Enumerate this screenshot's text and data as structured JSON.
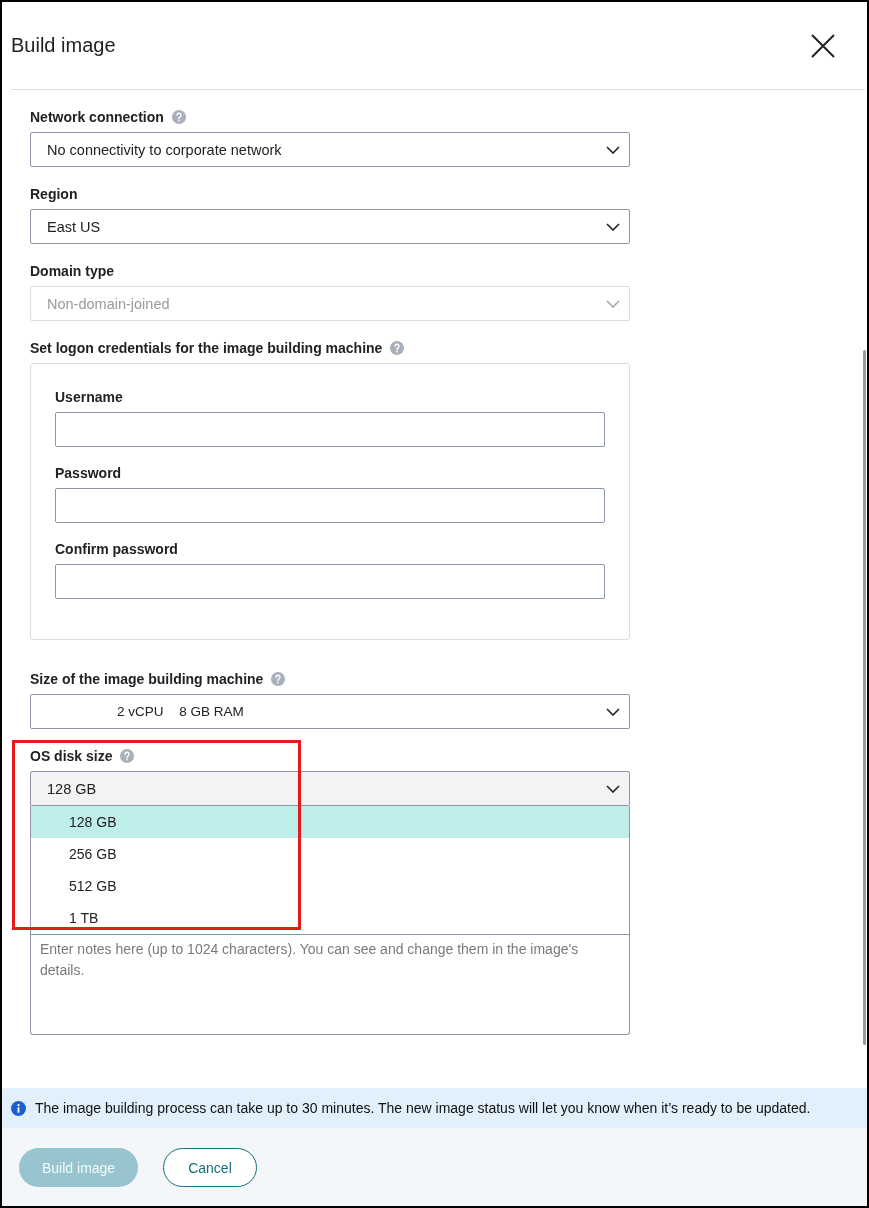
{
  "dialog": {
    "title": "Build image"
  },
  "fields": [
    {
      "kind": "select",
      "label": "Network connection",
      "help": true,
      "value": "No connectivity to corporate network",
      "disabled": false
    },
    {
      "kind": "select",
      "label": "Region",
      "help": false,
      "value": "East US",
      "disabled": false
    },
    {
      "kind": "select",
      "label": "Domain type",
      "help": false,
      "value": "Non-domain-joined",
      "disabled": true
    },
    {
      "kind": "group",
      "label": "Set logon credentials for the image building machine",
      "help": true,
      "fields": [
        {
          "label": "Username"
        },
        {
          "label": "Password"
        },
        {
          "label": "Confirm password"
        }
      ]
    },
    {
      "kind": "select",
      "label": "Size of the image building machine",
      "help": true,
      "value_parts": [
        "2 vCPU",
        "8 GB RAM"
      ],
      "disabled": false
    },
    {
      "kind": "select",
      "label": "OS disk size",
      "help": true,
      "value": "128 GB",
      "disabled": false,
      "expanded": true,
      "highlighted": true,
      "options": [
        {
          "label": "128 GB",
          "selected": true
        },
        {
          "label": "256 GB",
          "selected": false
        },
        {
          "label": "512 GB",
          "selected": false
        },
        {
          "label": "1 TB",
          "selected": false
        }
      ]
    },
    {
      "kind": "textarea",
      "placeholder": "Enter notes here (up to 1024 characters). You can see and change them in the image's details."
    }
  ],
  "info_message": "The image building process can take up to 30 minutes. The new image status will let you know when it’s ready to be updated.",
  "buttons": [
    {
      "label": "Build image",
      "kind": "primary",
      "disabled": true
    },
    {
      "label": "Cancel",
      "kind": "secondary",
      "disabled": false
    }
  ]
}
